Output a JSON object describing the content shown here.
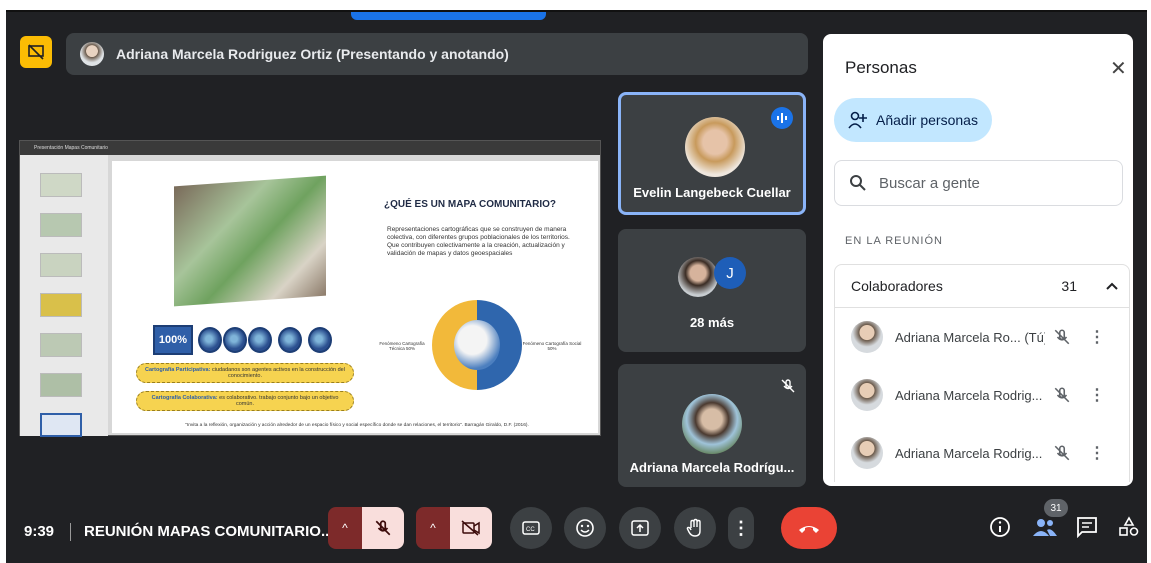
{
  "presenter": {
    "label": "Adriana Marcela Rodriguez Ortiz (Presentando y anotando)"
  },
  "slide": {
    "toolbar_title": "Presentación Mapas Comunitario",
    "title": "¿QUÉ ES UN MAPA COMUNITARIO?",
    "body": "Representaciones cartográficas que se construyen de manera colectiva, con diferentes grupos poblacionales de los territorios.\nQue contribuyen colectivamente a la creación, actualización y validación de mapas y datos geoespaciales",
    "percent": "100%",
    "pill_1_strong": "Cartografía Participativa:",
    "pill_1_text": " ciudadanos son agentes activos en la construcción del conocimiento.",
    "pill_2_strong": "Cartografía Colaborativa:",
    "pill_2_text": " es colaborativo. trabajo conjunto bajo un objetivo común.",
    "left_note": "Fenómeno Cartografía Técnica 50%",
    "right_note": "Fenómeno Cartografía Social 50%",
    "quote": "\"Invita a la reflexión, organización y acción alrededor de un espacio físico y social específico donde se dan relaciones, el territorio\". Barragán Giraldo, D.F. (2016)."
  },
  "tiles": {
    "evelin": "Evelin Langebeck Cuellar",
    "more_initial": "J",
    "more": "28 más",
    "adriana": "Adriana Marcela Rodrígu..."
  },
  "panel": {
    "title": "Personas",
    "add_people": "Añadir personas",
    "search_placeholder": "Buscar a gente",
    "section_label": "EN LA REUNIÓN",
    "group_label": "Colaboradores",
    "group_count": "31",
    "people": [
      {
        "name": "Adriana Marcela Ro... (Tú)"
      },
      {
        "name": "Adriana Marcela Rodrig..."
      },
      {
        "name": "Adriana Marcela Rodrig..."
      }
    ]
  },
  "bottom": {
    "time": "9:39",
    "meeting": "REUNIÓN MAPAS COMUNITARIO...",
    "people_count": "31"
  },
  "colors": {
    "accent": "#1a73e8",
    "end_call": "#ea4335",
    "muted_bg": "#f9dedc",
    "chip": "#c2e7ff"
  }
}
